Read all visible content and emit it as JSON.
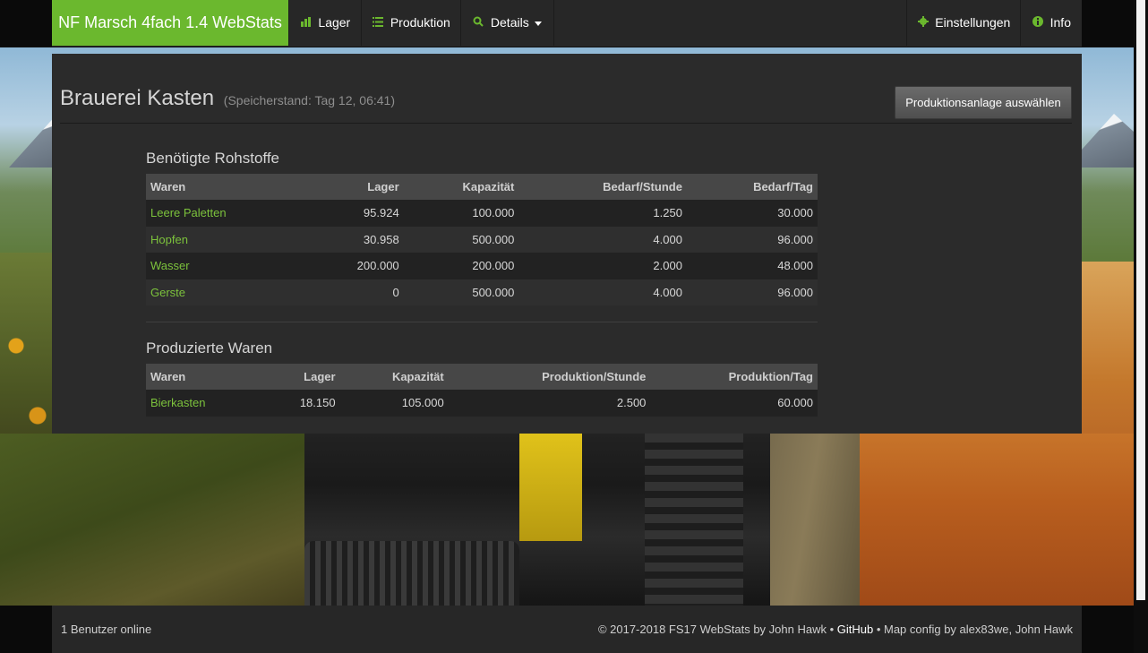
{
  "navbar": {
    "brand": "NF Marsch 4fach 1.4 WebStats",
    "lager": "Lager",
    "produktion": "Produktion",
    "details": "Details",
    "einstellungen": "Einstellungen",
    "info": "Info"
  },
  "header": {
    "title": "Brauerei Kasten",
    "subtitle": "(Speicherstand: Tag 12, 06:41)",
    "select_button": "Produktionsanlage auswählen"
  },
  "inputs": {
    "title": "Benötigte Rohstoffe",
    "columns": [
      "Waren",
      "Lager",
      "Kapazität",
      "Bedarf/Stunde",
      "Bedarf/Tag"
    ],
    "rows": [
      [
        "Leere Paletten",
        "95.924",
        "100.000",
        "1.250",
        "30.000"
      ],
      [
        "Hopfen",
        "30.958",
        "500.000",
        "4.000",
        "96.000"
      ],
      [
        "Wasser",
        "200.000",
        "200.000",
        "2.000",
        "48.000"
      ],
      [
        "Gerste",
        "0",
        "500.000",
        "4.000",
        "96.000"
      ]
    ]
  },
  "outputs": {
    "title": "Produzierte Waren",
    "columns": [
      "Waren",
      "Lager",
      "Kapazität",
      "Produktion/Stunde",
      "Produktion/Tag"
    ],
    "rows": [
      [
        "Bierkasten",
        "18.150",
        "105.000",
        "2.500",
        "60.000"
      ]
    ]
  },
  "footer": {
    "users_online": "1 Benutzer online",
    "copyright": "© 2017-2018 FS17 WebStats by John Hawk • ",
    "github": "GitHub",
    "map_config": " • Map config by alex83we, John Hawk"
  },
  "colors": {
    "accent": "#6bb82e",
    "link": "#7cc23c",
    "panel": "#2b2b2b",
    "navbar": "#272727"
  },
  "icons": {
    "lager": "bar-chart-icon",
    "produktion": "list-icon",
    "details": "search-icon",
    "einstellungen": "gear-icon",
    "info": "info-circle-icon"
  }
}
